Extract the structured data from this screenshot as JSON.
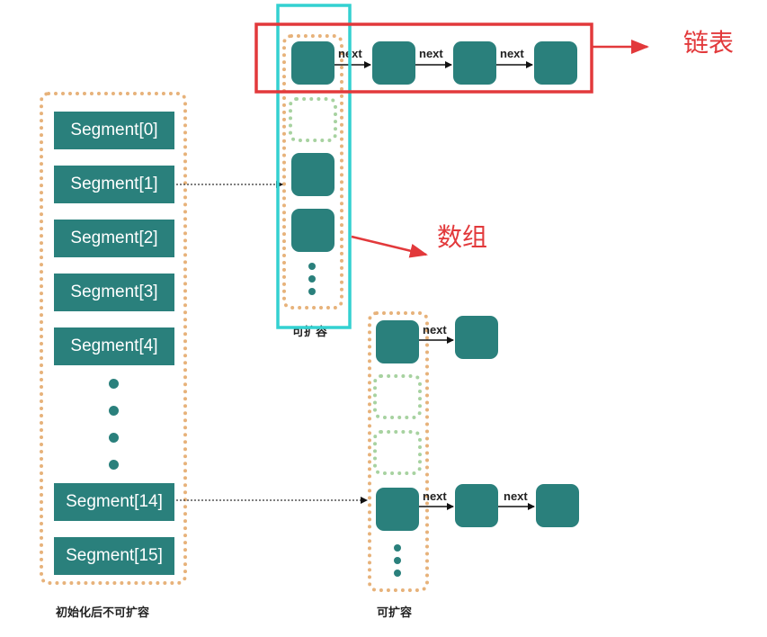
{
  "segments": {
    "items": [
      "Segment[0]",
      "Segment[1]",
      "Segment[2]",
      "Segment[3]",
      "Segment[4]",
      "Segment[14]",
      "Segment[15]"
    ],
    "caption": "初始化后不可扩容"
  },
  "array_top": {
    "caption": "可扩容"
  },
  "array_bottom": {
    "caption": "可扩容"
  },
  "link_label": "next",
  "annotations": {
    "linked_list": "链表",
    "array": "数组"
  },
  "colors": {
    "node": "#2a807c",
    "dotted_orange": "#e7b27a",
    "dotted_green": "#a7d2a0",
    "highlight_red": "#e2393b",
    "highlight_cyan": "#33d1d1"
  }
}
